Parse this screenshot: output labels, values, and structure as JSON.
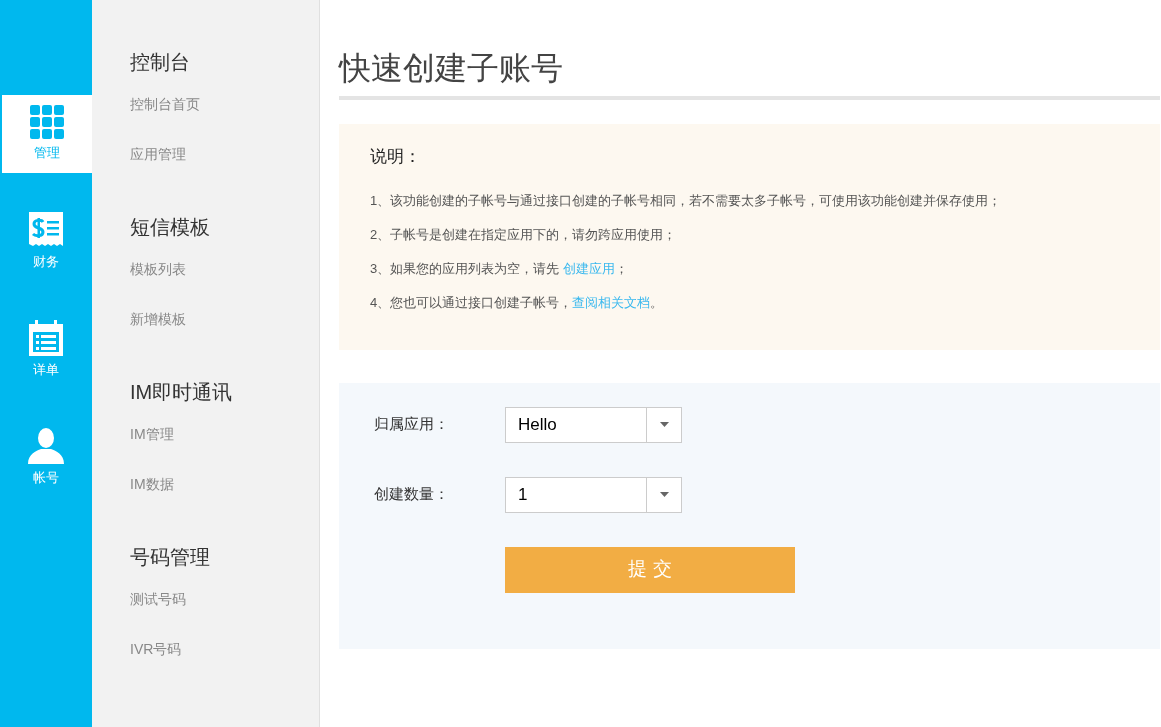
{
  "rail": [
    {
      "kind": "grid",
      "label": "管理",
      "selected": true
    },
    {
      "kind": "receipt",
      "label": "财务",
      "selected": false
    },
    {
      "kind": "calendar",
      "label": "详单",
      "selected": false
    },
    {
      "kind": "user",
      "label": "帐号",
      "selected": false
    }
  ],
  "sidebar": [
    {
      "heading": "控制台",
      "items": [
        "控制台首页",
        "应用管理"
      ]
    },
    {
      "heading": "短信模板",
      "items": [
        "模板列表",
        "新增模板"
      ]
    },
    {
      "heading": "IM即时通讯",
      "items": [
        "IM管理",
        "IM数据"
      ]
    },
    {
      "heading": "号码管理",
      "items": [
        "测试号码",
        "IVR号码"
      ]
    }
  ],
  "page_title": "快速创建子账号",
  "notes": {
    "title": "说明：",
    "lines": [
      {
        "text": "1、该功能创建的子帐号与通过接口创建的子帐号相同，若不需要太多子帐号，可使用该功能创建并保存使用；"
      },
      {
        "text": "2、子帐号是创建在指定应用下的，请勿跨应用使用；"
      },
      {
        "text": "3、如果您的应用列表为空，请先 ",
        "link": "创建应用",
        "after": "；"
      },
      {
        "text": "4、您也可以通过接口创建子帐号，",
        "link": "查阅相关文档",
        "after": "。"
      }
    ]
  },
  "form": {
    "fields": [
      {
        "label": "归属应用：",
        "value": "Hello"
      },
      {
        "label": "创建数量：",
        "value": "1"
      }
    ],
    "submit": "提 交"
  }
}
